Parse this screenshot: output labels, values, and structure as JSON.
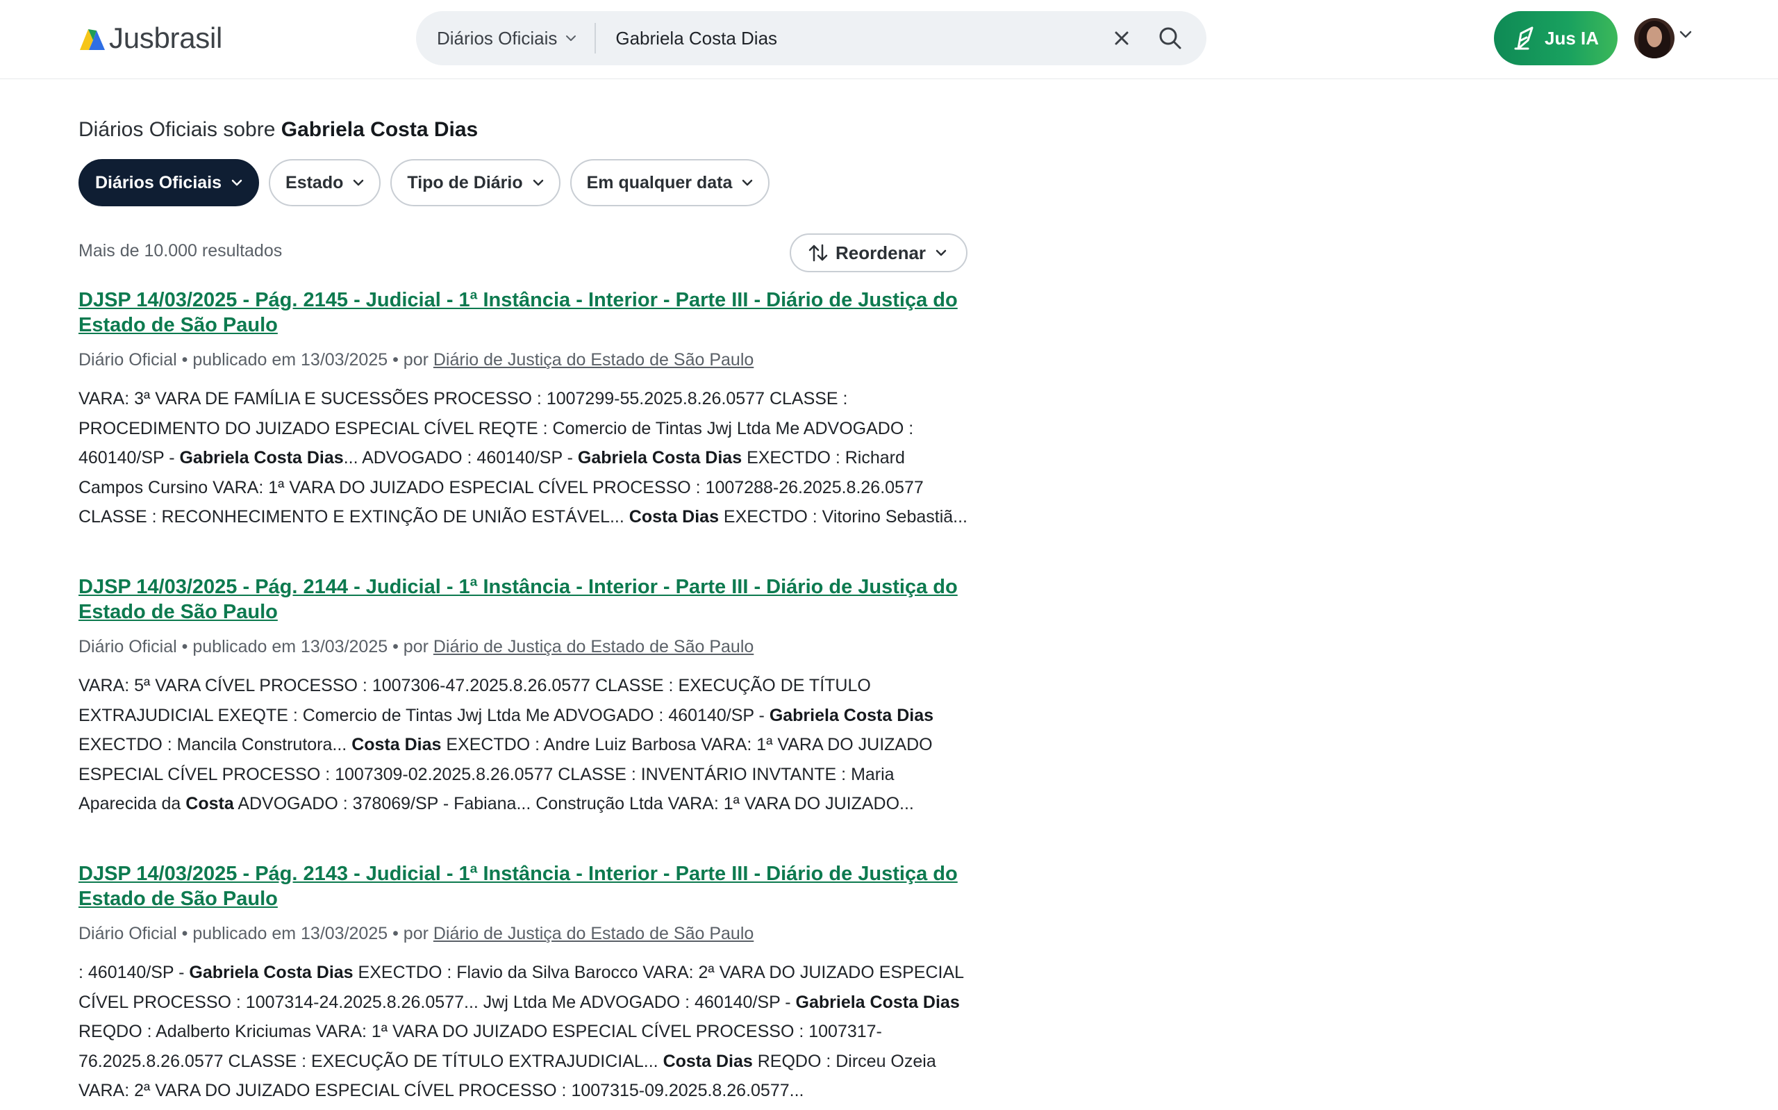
{
  "header": {
    "logo_text": "Jusbrasil",
    "search": {
      "scope": "Diários Oficiais",
      "query": "Gabriela Costa Dias"
    },
    "jus_ia_label": "Jus IA"
  },
  "main": {
    "title_prefix": "Diários Oficiais sobre ",
    "title_query": "Gabriela Costa Dias",
    "filters": [
      {
        "label": "Diários Oficiais",
        "active": true
      },
      {
        "label": "Estado",
        "active": false
      },
      {
        "label": "Tipo de Diário",
        "active": false
      },
      {
        "label": "Em qualquer data",
        "active": false
      }
    ],
    "results_count": "Mais de 10.000 resultados",
    "reorder_label": "Reordenar",
    "results": [
      {
        "title": "DJSP 14/03/2025 - Pág. 2145 - Judicial - 1ª Instância - Interior - Parte III - Diário de Justiça do Estado de São Paulo",
        "type": "Diário Oficial",
        "sep1": " • ",
        "published": "publicado em 13/03/2025",
        "sep2": " • por ",
        "source": "Diário de Justiça do Estado de São Paulo",
        "snippet": [
          {
            "t": "VARA: 3ª VARA DE FAMÍLIA E SUCESSÕES PROCESSO : 1007299-55.2025.8.26.0577 CLASSE : PROCEDIMENTO DO JUIZADO ESPECIAL CÍVEL REQTE : Comercio de Tintas Jwj Ltda Me ADVOGADO : 460140/SP - ",
            "b": false
          },
          {
            "t": "Gabriela Costa Dias",
            "b": true
          },
          {
            "t": "... ADVOGADO : 460140/SP - ",
            "b": false
          },
          {
            "t": "Gabriela Costa Dias",
            "b": true
          },
          {
            "t": " EXECTDO : Richard Campos Cursino VARA: 1ª VARA DO JUIZADO ESPECIAL CÍVEL PROCESSO : 1007288-26.2025.8.26.0577 CLASSE : RECONHECIMENTO E EXTINÇÃO DE UNIÃO ESTÁVEL... ",
            "b": false
          },
          {
            "t": "Costa Dias",
            "b": true
          },
          {
            "t": " EXECTDO : Vitorino Sebastiã...",
            "b": false
          }
        ]
      },
      {
        "title": "DJSP 14/03/2025 - Pág. 2144 - Judicial - 1ª Instância - Interior - Parte III - Diário de Justiça do Estado de São Paulo",
        "type": "Diário Oficial",
        "sep1": " • ",
        "published": "publicado em 13/03/2025",
        "sep2": " • por ",
        "source": "Diário de Justiça do Estado de São Paulo",
        "snippet": [
          {
            "t": "VARA: 5ª VARA CÍVEL PROCESSO : 1007306-47.2025.8.26.0577 CLASSE : EXECUÇÃO DE TÍTULO EXTRAJUDICIAL EXEQTE : Comercio de Tintas Jwj Ltda Me ADVOGADO : 460140/SP - ",
            "b": false
          },
          {
            "t": "Gabriela Costa Dias",
            "b": true
          },
          {
            "t": " EXECTDO : Mancila Construtora... ",
            "b": false
          },
          {
            "t": "Costa Dias",
            "b": true
          },
          {
            "t": " EXECTDO : Andre Luiz Barbosa VARA: 1ª VARA DO JUIZADO ESPECIAL CÍVEL PROCESSO : 1007309-02.2025.8.26.0577 CLASSE : INVENTÁRIO INVTANTE : Maria Aparecida da ",
            "b": false
          },
          {
            "t": "Costa",
            "b": true
          },
          {
            "t": " ADVOGADO : 378069/SP - Fabiana... Construção Ltda VARA: 1ª VARA DO JUIZADO...",
            "b": false
          }
        ]
      },
      {
        "title": "DJSP 14/03/2025 - Pág. 2143 - Judicial - 1ª Instância - Interior - Parte III - Diário de Justiça do Estado de São Paulo",
        "type": "Diário Oficial",
        "sep1": " • ",
        "published": "publicado em 13/03/2025",
        "sep2": " • por ",
        "source": "Diário de Justiça do Estado de São Paulo",
        "snippet": [
          {
            "t": ": 460140/SP - ",
            "b": false
          },
          {
            "t": "Gabriela Costa Dias",
            "b": true
          },
          {
            "t": " EXECTDO : Flavio da Silva Barocco VARA: 2ª VARA DO JUIZADO ESPECIAL CÍVEL PROCESSO : 1007314-24.2025.8.26.0577... Jwj Ltda Me ADVOGADO : 460140/SP - ",
            "b": false
          },
          {
            "t": "Gabriela Costa Dias",
            "b": true
          },
          {
            "t": " REQDO : Adalberto Kriciumas VARA: 1ª VARA DO JUIZADO ESPECIAL CÍVEL PROCESSO : 1007317-76.2025.8.26.0577 CLASSE : EXECUÇÃO DE TÍTULO EXTRAJUDICIAL... ",
            "b": false
          },
          {
            "t": "Costa Dias",
            "b": true
          },
          {
            "t": " REQDO : Dirceu Ozeia VARA: 2ª VARA DO JUIZADO ESPECIAL CÍVEL PROCESSO : 1007315-09.2025.8.26.0577...",
            "b": false
          }
        ]
      }
    ]
  },
  "colors": {
    "link_green": "#0d7a4f",
    "chip_active_bg": "#0f1e33",
    "jus_ia_green": "#19a15f"
  }
}
